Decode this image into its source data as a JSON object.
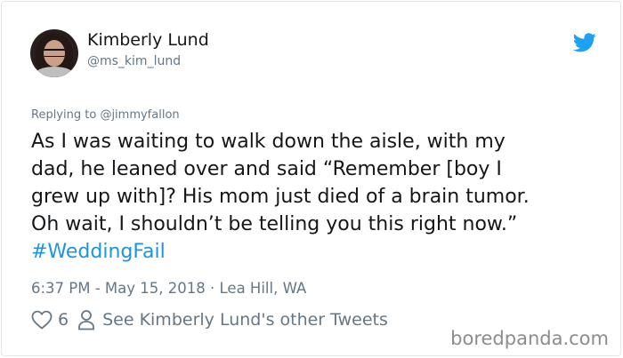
{
  "tweet": {
    "author_name": "Kimberly Lund",
    "author_handle": "@ms_kim_lund",
    "replying_prefix": "Replying to ",
    "replying_to": "@jimmyfallon",
    "body_lines": [
      "As I was waiting to walk down the aisle, with my",
      "dad, he leaned over and said “Remember [boy I",
      "grew up with]? His mom just died of a brain tumor.",
      "Oh wait, I shouldn’t be telling you this right now.”"
    ],
    "hashtag": "#WeddingFail",
    "timestamp": "6:37 PM - May 15, 2018",
    "separator": " · ",
    "location": "Lea Hill, WA",
    "like_count": "6",
    "other_tweets_label": "See Kimberly Lund's other Tweets"
  },
  "icons": {
    "avatar": "profile-photo",
    "brand": "twitter-bird-icon",
    "like": "heart-outline-icon",
    "profile": "person-outline-icon"
  },
  "colors": {
    "brand_blue": "#1da1f2",
    "hashtag": "#1b95e0",
    "secondary_text": "#657786",
    "primary_text": "#14171a",
    "border": "#e1e8ed"
  },
  "watermark": "boredpanda.com"
}
